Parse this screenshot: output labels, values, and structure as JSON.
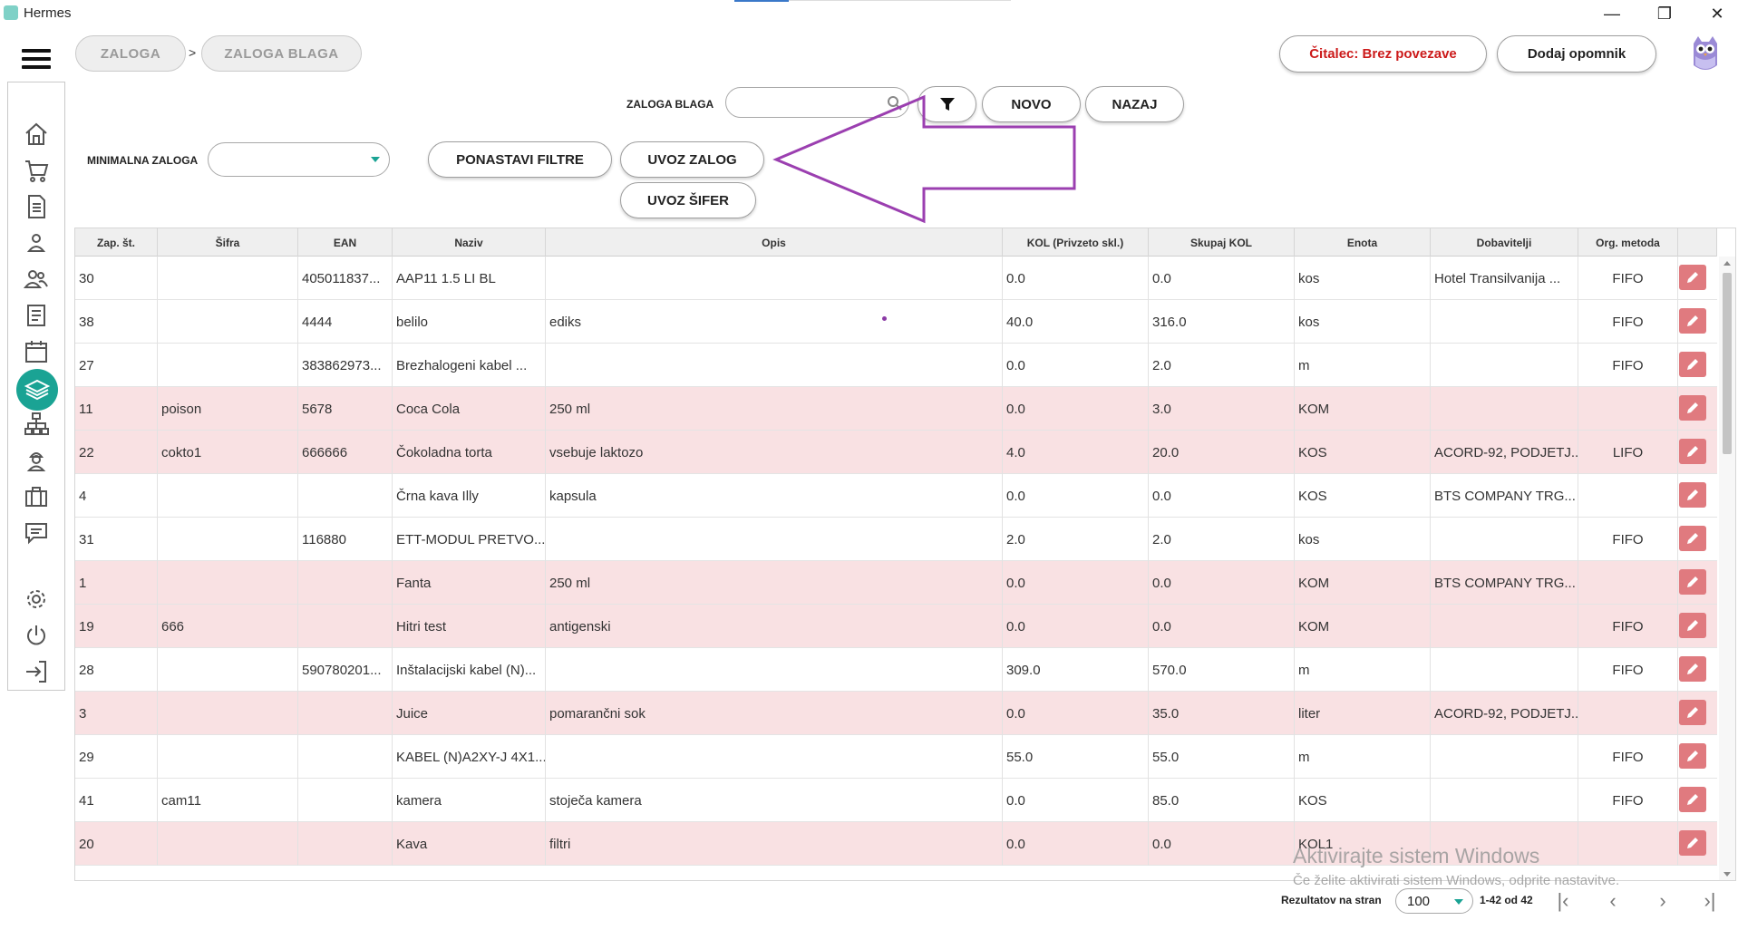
{
  "window": {
    "title": "Hermes",
    "minimize_glyph": "—",
    "maximize_glyph": "❐",
    "close_glyph": "✕"
  },
  "breadcrumb": {
    "items": [
      "ZALOGA",
      "ZALOGA BLAGA"
    ],
    "separator": ">"
  },
  "header": {
    "reader_status": "Čitalec: Brez povezave",
    "reminder_button": "Dodaj opomnik",
    "reader_color": "#cc1a1a"
  },
  "sidebar": {
    "icons": [
      "home-icon",
      "cart-icon",
      "document-icon",
      "user-icon",
      "users-icon",
      "list-icon",
      "calendar-icon",
      "layers-icon",
      "network-icon",
      "worker-icon",
      "briefcase-icon",
      "chat-icon",
      "gear-icon",
      "power-icon",
      "logout-icon"
    ],
    "active": "layers-icon",
    "accent_color": "#1aa394"
  },
  "toolbar": {
    "search_label": "ZALOGA BLAGA",
    "search_value": "",
    "filter_icon": "filter-icon",
    "new_button": "NOVO",
    "back_button": "NAZAJ",
    "min_stock_label": "MINIMALNA ZALOGA",
    "min_stock_value": "",
    "reset_filters_button": "PONASTAVI FILTRE",
    "import_stock_button": "UVOZ ZALOG",
    "import_codes_button": "UVOZ ŠIFER"
  },
  "table": {
    "columns": [
      "Zap. št.",
      "Šifra",
      "EAN",
      "Naziv",
      "Opis",
      "KOL (Privzeto skl.)",
      "Skupaj KOL",
      "Enota",
      "Dobavitelji",
      "Org. metoda"
    ],
    "rows": [
      [
        "30",
        "",
        "405011837...",
        "AAP11 1.5 LI BL",
        "",
        "0.0",
        "0.0",
        "kos",
        "Hotel Transilvanija ...",
        "FIFO"
      ],
      [
        "38",
        "",
        "4444",
        "belilo",
        "ediks",
        "40.0",
        "316.0",
        "kos",
        "",
        "FIFO"
      ],
      [
        "27",
        "",
        "383862973...",
        "Brezhalogeni kabel ...",
        "",
        "0.0",
        "2.0",
        "m",
        "",
        "FIFO"
      ],
      [
        "11",
        "poison",
        "5678",
        "Coca Cola",
        "250 ml",
        "0.0",
        "3.0",
        "KOM",
        "",
        ""
      ],
      [
        "22",
        "cokto1",
        "666666",
        "Čokoladna torta",
        "vsebuje laktozo",
        "4.0",
        "20.0",
        "KOS",
        "ACORD-92, PODJETJ...",
        "LIFO"
      ],
      [
        "4",
        "",
        "",
        "Črna kava Illy",
        "kapsula",
        "0.0",
        "0.0",
        "KOS",
        "BTS COMPANY TRG...",
        ""
      ],
      [
        "31",
        "",
        "116880",
        "ETT-MODUL PRETVO...",
        "",
        "2.0",
        "2.0",
        "kos",
        "",
        "FIFO"
      ],
      [
        "1",
        "",
        "",
        "Fanta",
        "250 ml",
        "0.0",
        "0.0",
        "KOM",
        "BTS COMPANY TRG...",
        ""
      ],
      [
        "19",
        "666",
        "",
        "Hitri test",
        "antigenski",
        "0.0",
        "0.0",
        "KOM",
        "",
        "FIFO"
      ],
      [
        "28",
        "",
        "590780201...",
        "Inštalacijski kabel (N)...",
        "",
        "309.0",
        "570.0",
        "m",
        "",
        "FIFO"
      ],
      [
        "3",
        "",
        "",
        "Juice",
        "pomarančni sok",
        "0.0",
        "35.0",
        "liter",
        "ACORD-92, PODJETJ...",
        ""
      ],
      [
        "29",
        "",
        "",
        "KABEL (N)A2XY-J 4X1...",
        "",
        "55.0",
        "55.0",
        "m",
        "",
        "FIFO"
      ],
      [
        "41",
        "cam11",
        "",
        "kamera",
        "stoječa kamera",
        "0.0",
        "85.0",
        "KOS",
        "",
        "FIFO"
      ],
      [
        "20",
        "",
        "",
        "Kava",
        "filtri",
        "0.0",
        "0.0",
        "KOL1",
        "",
        ""
      ]
    ],
    "pink_rows": [
      3,
      4,
      7,
      8,
      10,
      13
    ],
    "row_highlight_color": "#f9e1e3",
    "edit_button_color": "#e07a7f",
    "edit_icon": "pencil-icon"
  },
  "footer": {
    "per_page_label": "Rezultatov na stran",
    "per_page_value": "100",
    "range_text": "1-42 od 42",
    "first_icon": "first-page-icon",
    "prev_icon": "prev-page-icon",
    "next_icon": "next-page-icon",
    "last_icon": "last-page-icon"
  },
  "watermark": {
    "line1": "Aktivirajte sistem Windows",
    "line2": "Če želite aktivirati sistem Windows, odprite nastavitve."
  },
  "annotation": {
    "arrow_color": "#9b3fb0"
  }
}
